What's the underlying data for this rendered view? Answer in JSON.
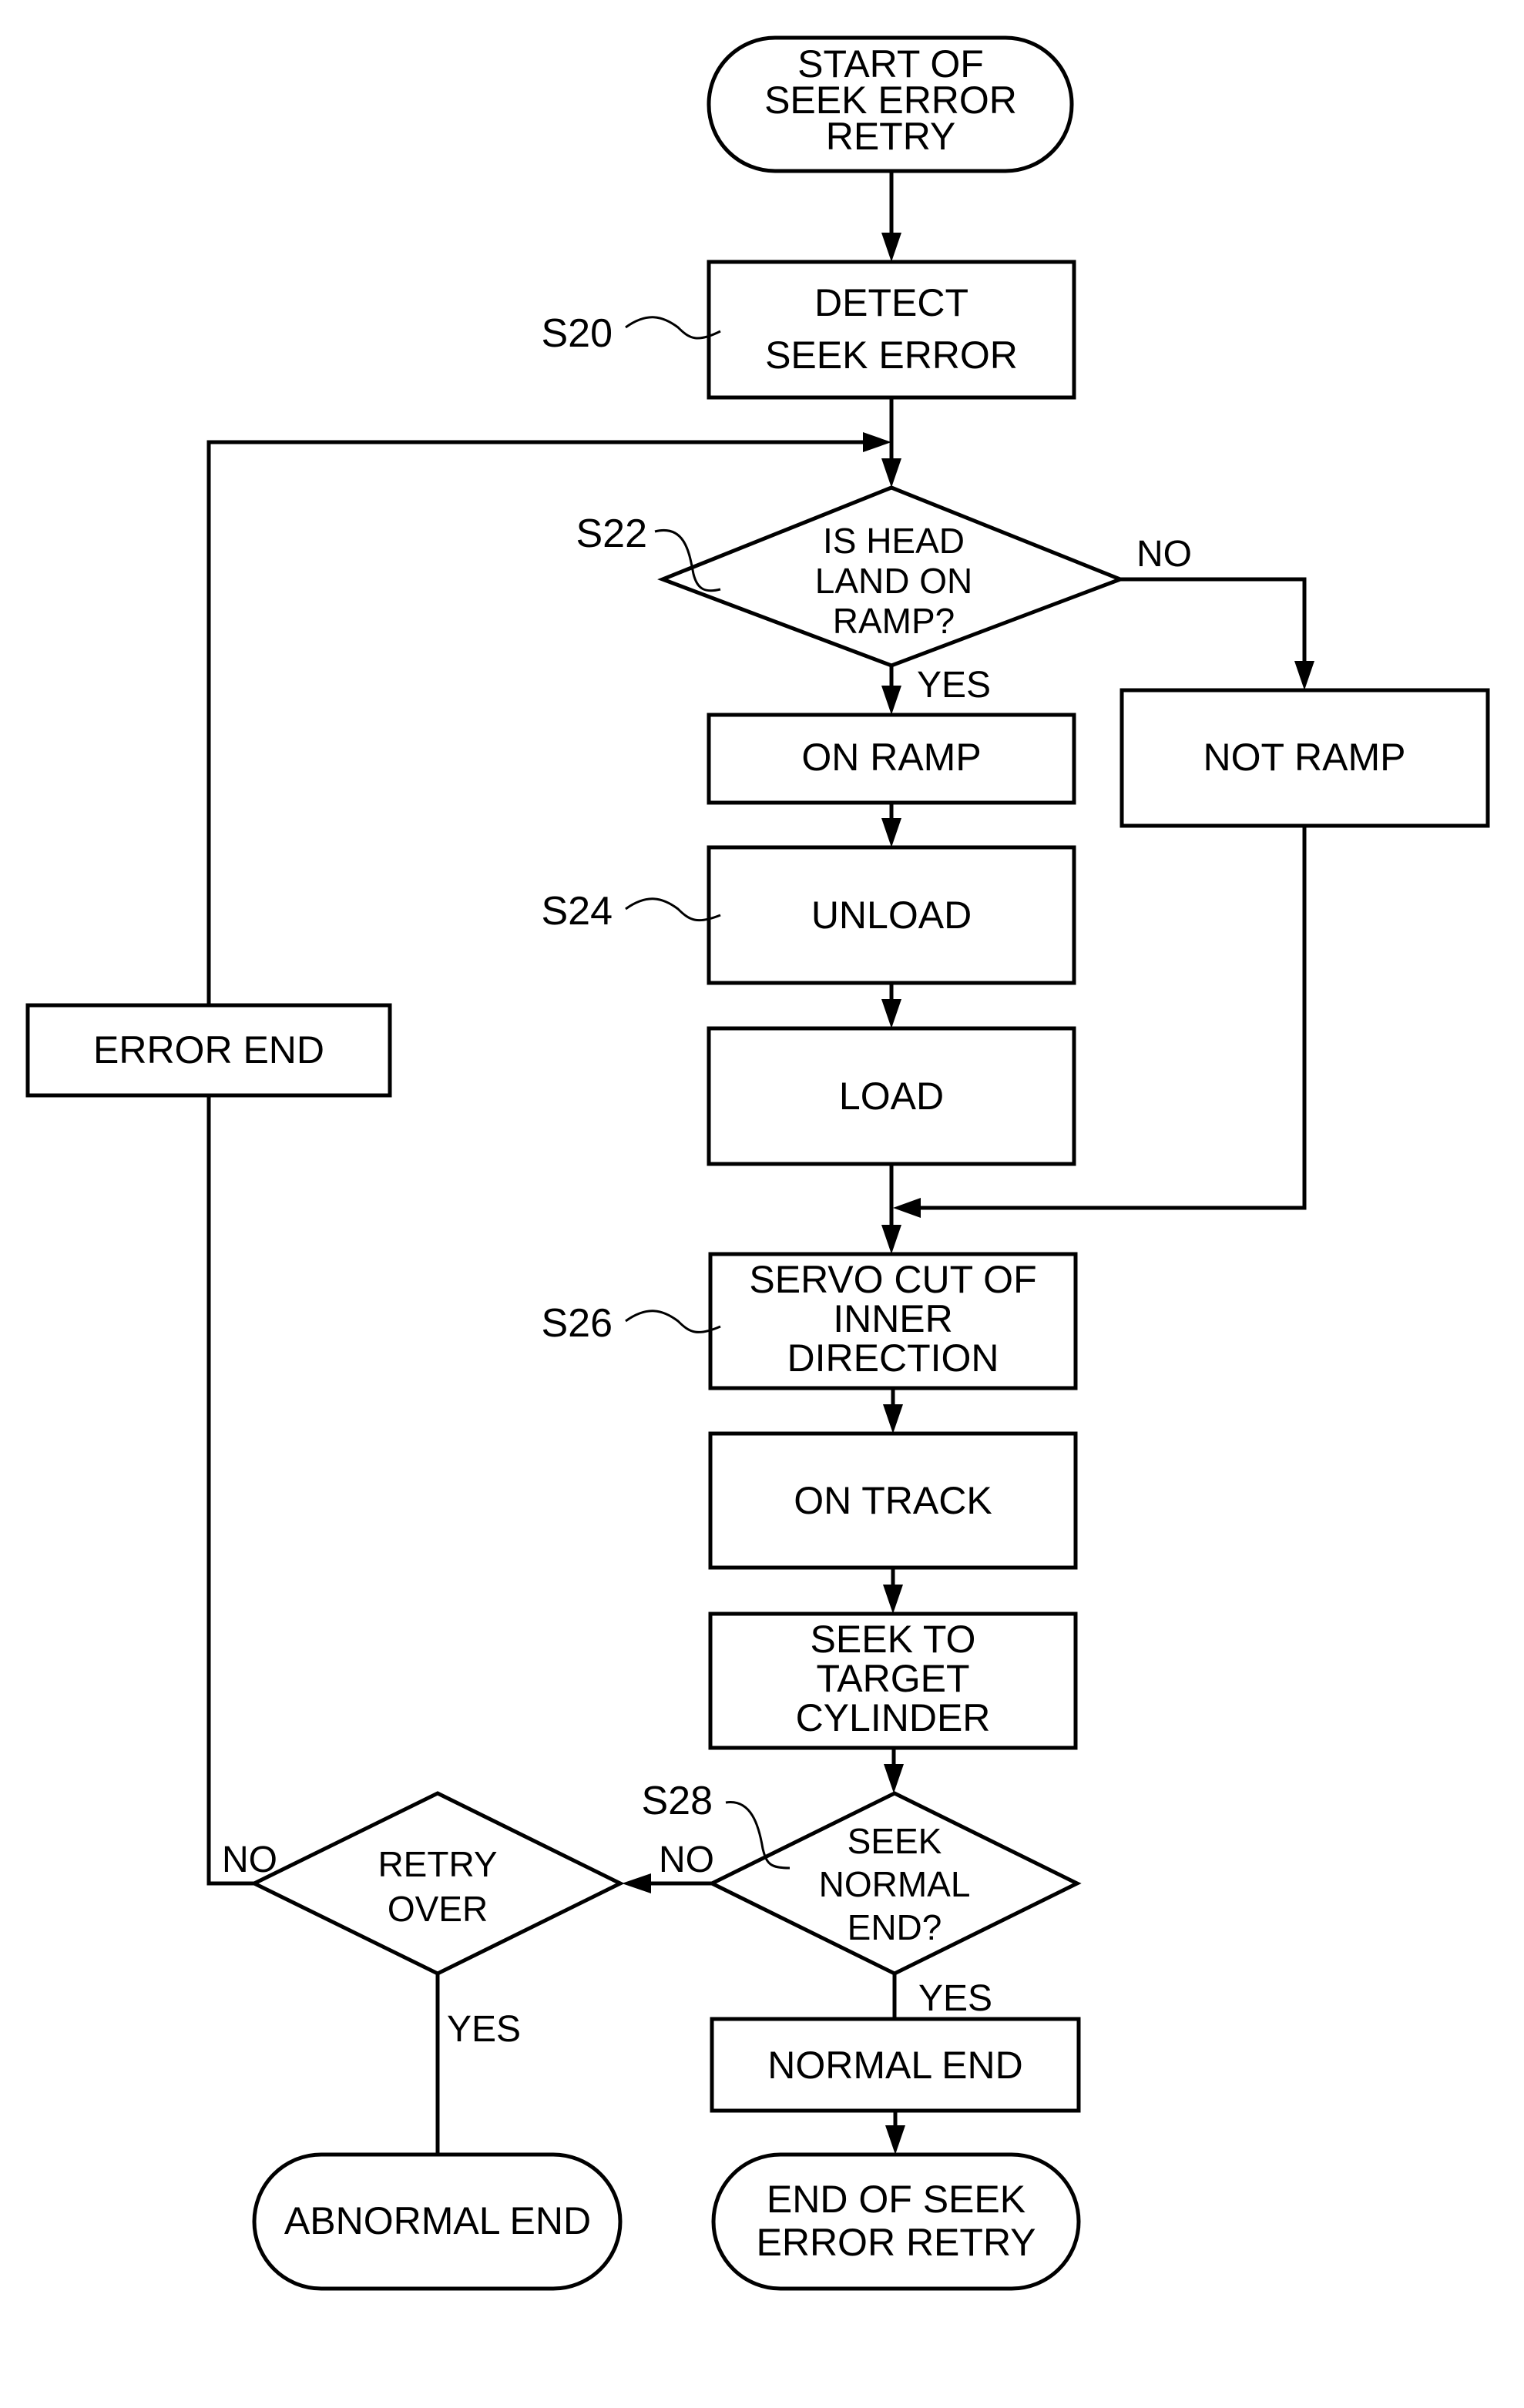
{
  "diagram": {
    "type": "flowchart",
    "nodes": {
      "start": {
        "lines": [
          "START OF",
          "SEEK ERROR",
          "RETRY"
        ]
      },
      "detect": {
        "lines": [
          "DETECT",
          "SEEK ERROR"
        ],
        "step": "S20"
      },
      "is_head_land": {
        "lines": [
          "IS HEAD",
          "LAND ON",
          "RAMP?"
        ],
        "step": "S22"
      },
      "on_ramp": {
        "lines": [
          "ON RAMP"
        ]
      },
      "not_ramp": {
        "lines": [
          "NOT RAMP"
        ]
      },
      "unload": {
        "lines": [
          "UNLOAD"
        ],
        "step": "S24"
      },
      "load": {
        "lines": [
          "LOAD"
        ]
      },
      "servo_cut": {
        "lines": [
          "SERVO CUT OF",
          "INNER",
          "DIRECTION"
        ],
        "step": "S26"
      },
      "on_track": {
        "lines": [
          "ON TRACK"
        ]
      },
      "seek_target": {
        "lines": [
          "SEEK TO",
          "TARGET",
          "CYLINDER"
        ]
      },
      "seek_normal_end": {
        "lines": [
          "SEEK",
          "NORMAL",
          "END?"
        ],
        "step": "S28"
      },
      "retry_over": {
        "lines": [
          "RETRY",
          "OVER"
        ]
      },
      "normal_end": {
        "lines": [
          "NORMAL END"
        ]
      },
      "end": {
        "lines": [
          "END OF SEEK",
          "ERROR RETRY"
        ]
      },
      "abnormal_end": {
        "lines": [
          "ABNORMAL END"
        ]
      },
      "error_end": {
        "lines": [
          "ERROR END"
        ]
      }
    },
    "edge_labels": {
      "s22_no": "NO",
      "s22_yes": "YES",
      "s28_no": "NO",
      "s28_yes": "YES",
      "retry_no": "NO",
      "retry_yes": "YES"
    }
  }
}
